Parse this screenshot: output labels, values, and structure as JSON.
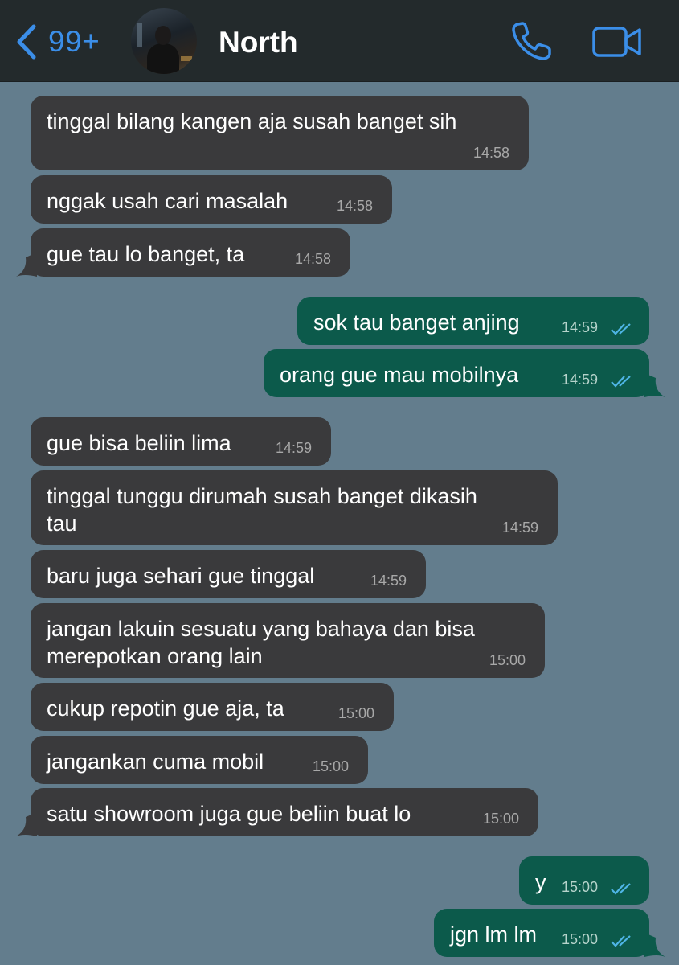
{
  "header": {
    "unread_count": "99+",
    "contact_name": "North",
    "accent_color": "#3b8ee8",
    "icons": [
      "chevron-left-icon",
      "phone-icon",
      "video-camera-icon"
    ]
  },
  "messages": [
    {
      "dir": "in",
      "text": "tinggal bilang kangen aja susah banget sih",
      "time": "14:58"
    },
    {
      "dir": "in",
      "text": "nggak usah cari masalah",
      "time": "14:58"
    },
    {
      "dir": "in",
      "text": "gue tau lo banget, ta",
      "time": "14:58"
    },
    {
      "dir": "out",
      "text": "sok tau banget anjing",
      "time": "14:59",
      "status": "read"
    },
    {
      "dir": "out",
      "text": "orang gue mau mobilnya",
      "time": "14:59",
      "status": "read"
    },
    {
      "dir": "in",
      "text": "gue bisa beliin lima",
      "time": "14:59"
    },
    {
      "dir": "in",
      "text": "tinggal tunggu dirumah susah banget dikasih",
      "text2": "tau",
      "time": "14:59"
    },
    {
      "dir": "in",
      "text": "baru juga sehari gue tinggal",
      "time": "14:59"
    },
    {
      "dir": "in",
      "text": "jangan lakuin sesuatu yang bahaya dan bisa",
      "text2": "merepotkan orang lain",
      "time": "15:00"
    },
    {
      "dir": "in",
      "text": "cukup repotin gue aja, ta",
      "time": "15:00"
    },
    {
      "dir": "in",
      "text": "jangankan cuma mobil",
      "time": "15:00"
    },
    {
      "dir": "in",
      "text": "satu showroom juga gue beliin buat lo",
      "time": "15:00"
    },
    {
      "dir": "out",
      "text": "y",
      "time": "15:00",
      "status": "read"
    },
    {
      "dir": "out",
      "text": "jgn lm lm",
      "time": "15:00",
      "status": "read"
    }
  ],
  "colors": {
    "chat_bg": "#637d8d",
    "incoming_bubble": "#3a3a3c",
    "outgoing_bubble": "#0c5a4b",
    "read_tick": "#4fb5e6"
  }
}
